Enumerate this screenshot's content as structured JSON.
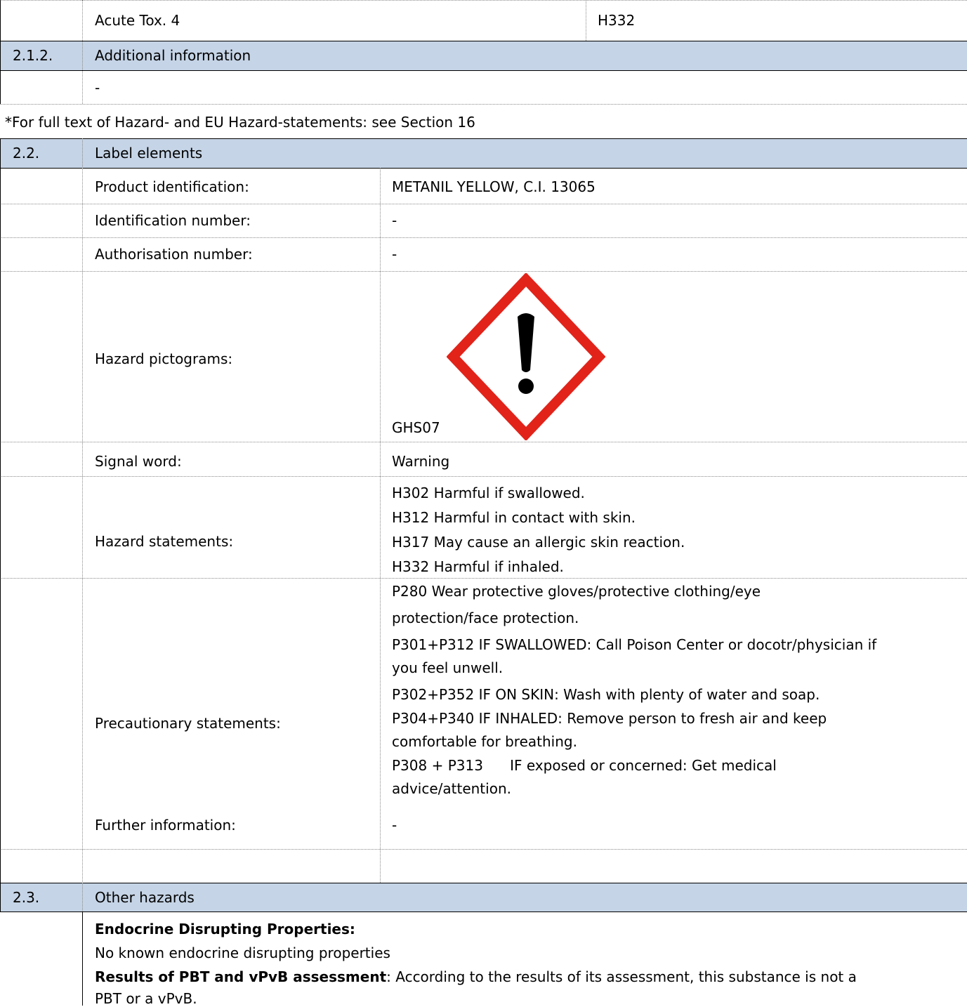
{
  "row_acute_tox": {
    "label": "Acute Tox. 4",
    "code": "H332"
  },
  "section_2_1_2": {
    "number": "2.1.2.",
    "title": "Additional information",
    "value": "-"
  },
  "full_text_note": "*For full text of Hazard- and EU Hazard-statements: see Section 16",
  "section_2_2": {
    "number": "2.2.",
    "title": "Label elements",
    "product_identification": {
      "label": "Product identification:",
      "value": "METANIL YELLOW, C.I. 13065"
    },
    "identification_number": {
      "label": "Identification number:",
      "value": "-"
    },
    "authorisation_number": {
      "label": "Authorisation number:",
      "value": "-"
    },
    "hazard_pictograms": {
      "label": "Hazard pictograms:",
      "code": "GHS07",
      "icon": "exclamation-mark-pictogram-icon",
      "border_color": "#e2231a"
    },
    "signal_word": {
      "label": "Signal word:",
      "value": "Warning"
    },
    "hazard_statements": {
      "label": "Hazard statements:",
      "items": [
        "H302  Harmful if swallowed.",
        "H312  Harmful in contact with skin.",
        "H317  May cause an allergic skin reaction.",
        "H332  Harmful if inhaled."
      ]
    },
    "precautionary_statements": {
      "label": "Precautionary statements:",
      "lines": [
        "P280 Wear protective gloves/protective clothing/eye",
        "protection/face protection.",
        "P301+P312 IF SWALLOWED: Call Poison Center or docotr/physician if",
        "you feel unwell.",
        "P302+P352 IF ON SKIN: Wash with plenty of water and soap.",
        "P304+P340 IF INHALED: Remove person to fresh air and keep",
        "comfortable for breathing.",
        "P308 + P313      IF exposed or concerned: Get medical",
        "advice/attention."
      ]
    },
    "further_information": {
      "label": "Further information:",
      "value": "-"
    }
  },
  "section_2_3": {
    "number": "2.3.",
    "title": "Other hazards",
    "endocrine_heading": "Endocrine Disrupting Properties:",
    "endocrine_text": "No known endocrine disrupting properties",
    "pbt_heading": "Results of PBT and vPvB assessment",
    "pbt_text": ":  According to the results of its assessment, this substance is not a",
    "pbt_text_2": "PBT or a vPvB."
  },
  "colors": {
    "header_bg": "#c5d4e6",
    "pictogram_red": "#e2231a"
  }
}
